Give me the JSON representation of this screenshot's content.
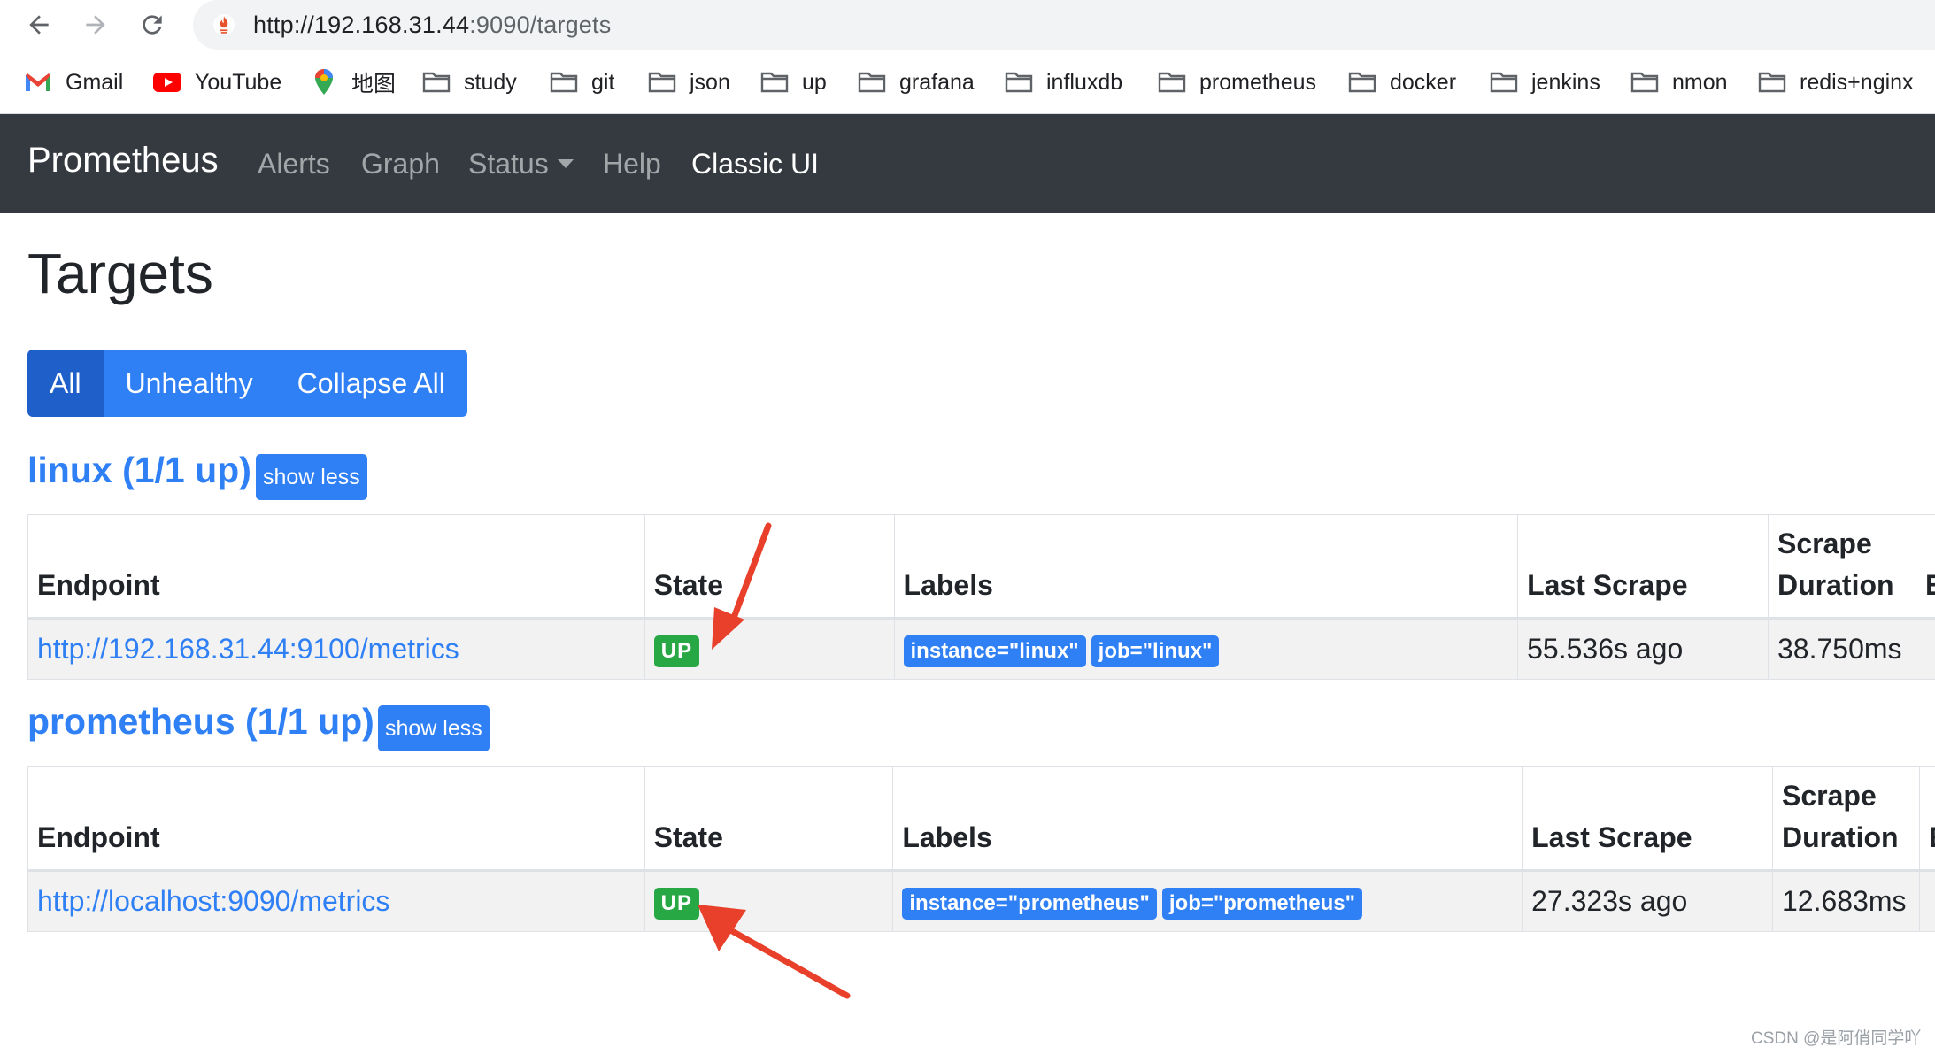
{
  "browser": {
    "url_host": "http://192.168.31.44",
    "url_rest": ":9090/targets",
    "bookmarks": [
      {
        "label": "Gmail",
        "icon": "gmail-icon"
      },
      {
        "label": "YouTube",
        "icon": "youtube-icon"
      },
      {
        "label": "地图",
        "icon": "maps-pin-icon"
      },
      {
        "label": "study",
        "icon": "folder-icon"
      },
      {
        "label": "git",
        "icon": "folder-icon"
      },
      {
        "label": "json",
        "icon": "folder-icon"
      },
      {
        "label": "up",
        "icon": "folder-icon"
      },
      {
        "label": "grafana",
        "icon": "folder-icon"
      },
      {
        "label": "influxdb",
        "icon": "folder-icon"
      },
      {
        "label": "prometheus",
        "icon": "folder-icon"
      },
      {
        "label": "docker",
        "icon": "folder-icon"
      },
      {
        "label": "jenkins",
        "icon": "folder-icon"
      },
      {
        "label": "nmon",
        "icon": "folder-icon"
      },
      {
        "label": "redis+nginx",
        "icon": "folder-icon"
      }
    ]
  },
  "navbar": {
    "brand": "Prometheus",
    "links": [
      "Alerts",
      "Graph",
      "Status",
      "Help",
      "Classic UI"
    ]
  },
  "page": {
    "title": "Targets",
    "filters": [
      "All",
      "Unhealthy",
      "Collapse All"
    ]
  },
  "jobs": [
    {
      "title": "linux (1/1 up)",
      "toggle": "show less",
      "headers": [
        "Endpoint",
        "State",
        "Labels",
        "Last Scrape",
        "Scrape Duration",
        "E"
      ],
      "row": {
        "endpoint": "http://192.168.31.44:9100/metrics",
        "state": "UP",
        "labels": [
          "instance=\"linux\"",
          "job=\"linux\""
        ],
        "last_scrape": "55.536s ago",
        "duration": "38.750ms"
      }
    },
    {
      "title": "prometheus (1/1 up)",
      "toggle": "show less",
      "headers": [
        "Endpoint",
        "State",
        "Labels",
        "Last Scrape",
        "Scrape Duration",
        "E"
      ],
      "row": {
        "endpoint": "http://localhost:9090/metrics",
        "state": "UP",
        "labels": [
          "instance=\"prometheus\"",
          "job=\"prometheus\""
        ],
        "last_scrape": "27.323s ago",
        "duration": "12.683ms"
      }
    }
  ],
  "colors": {
    "navbar_bg": "#343a40",
    "primary": "#2f7ff5",
    "success": "#28a745",
    "annotation_arrow": "#e8402a"
  },
  "watermark": "CSDN @是阿俏同学吖"
}
